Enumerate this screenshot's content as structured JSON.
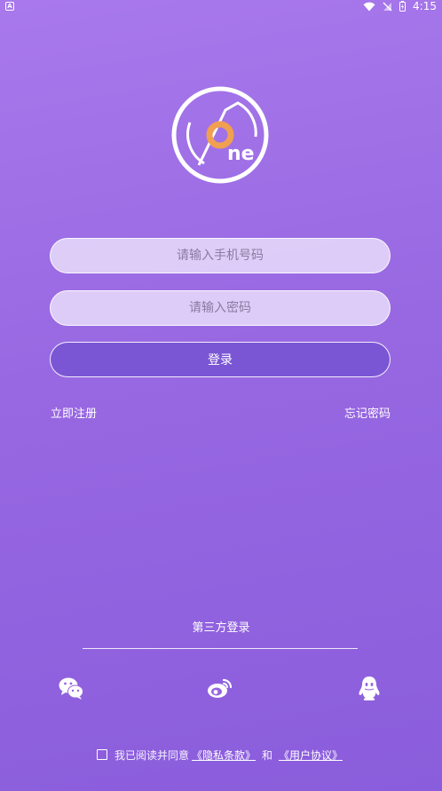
{
  "status_bar": {
    "notification_label": "A",
    "time": "4:15"
  },
  "logo": {
    "text": "ne",
    "ring_color": "#ffffff",
    "accent_color": "#f0a050"
  },
  "form": {
    "phone_placeholder": "请输入手机号码",
    "password_placeholder": "请输入密码",
    "login_label": "登录"
  },
  "links": {
    "register": "立即注册",
    "forgot_password": "忘记密码"
  },
  "third_party": {
    "title": "第三方登录",
    "icons": [
      "wechat-icon",
      "weibo-icon",
      "qq-icon"
    ]
  },
  "agreement": {
    "prefix": "我已阅读并同意",
    "privacy_link": "《隐私条款》",
    "and_text": "和",
    "user_link": "《用户协议》"
  },
  "colors": {
    "background_top": "#a878ec",
    "background_bottom": "#8a5ddc",
    "login_button": "#7b56d4",
    "input_bg": "#f0e8fc"
  }
}
